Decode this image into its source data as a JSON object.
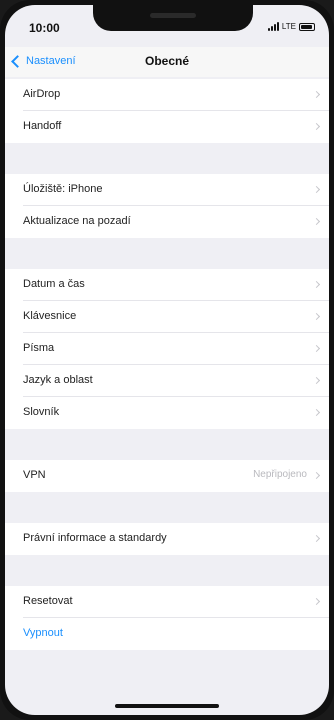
{
  "status": {
    "time": "10:00",
    "network": "LTE"
  },
  "nav": {
    "back_label": "Nastavení",
    "title": "Obecné"
  },
  "groups": [
    {
      "rows": [
        {
          "label": "AirDrop",
          "value": ""
        },
        {
          "label": "Handoff",
          "value": ""
        }
      ]
    },
    {
      "rows": [
        {
          "label": "Úložiště: iPhone",
          "value": ""
        },
        {
          "label": "Aktualizace na pozadí",
          "value": ""
        }
      ]
    },
    {
      "rows": [
        {
          "label": "Datum a čas",
          "value": ""
        },
        {
          "label": "Klávesnice",
          "value": ""
        },
        {
          "label": "Písma",
          "value": ""
        },
        {
          "label": "Jazyk a oblast",
          "value": ""
        },
        {
          "label": "Slovník",
          "value": ""
        }
      ]
    },
    {
      "rows": [
        {
          "label": "VPN",
          "value": "Nepřipojeno"
        }
      ]
    },
    {
      "rows": [
        {
          "label": "Právní informace a standardy",
          "value": ""
        }
      ]
    },
    {
      "rows": [
        {
          "label": "Resetovat",
          "value": ""
        },
        {
          "label": "Vypnout",
          "value": ""
        }
      ]
    }
  ],
  "colors": {
    "accent": "#1a8ffd",
    "background": "#efeff4"
  }
}
